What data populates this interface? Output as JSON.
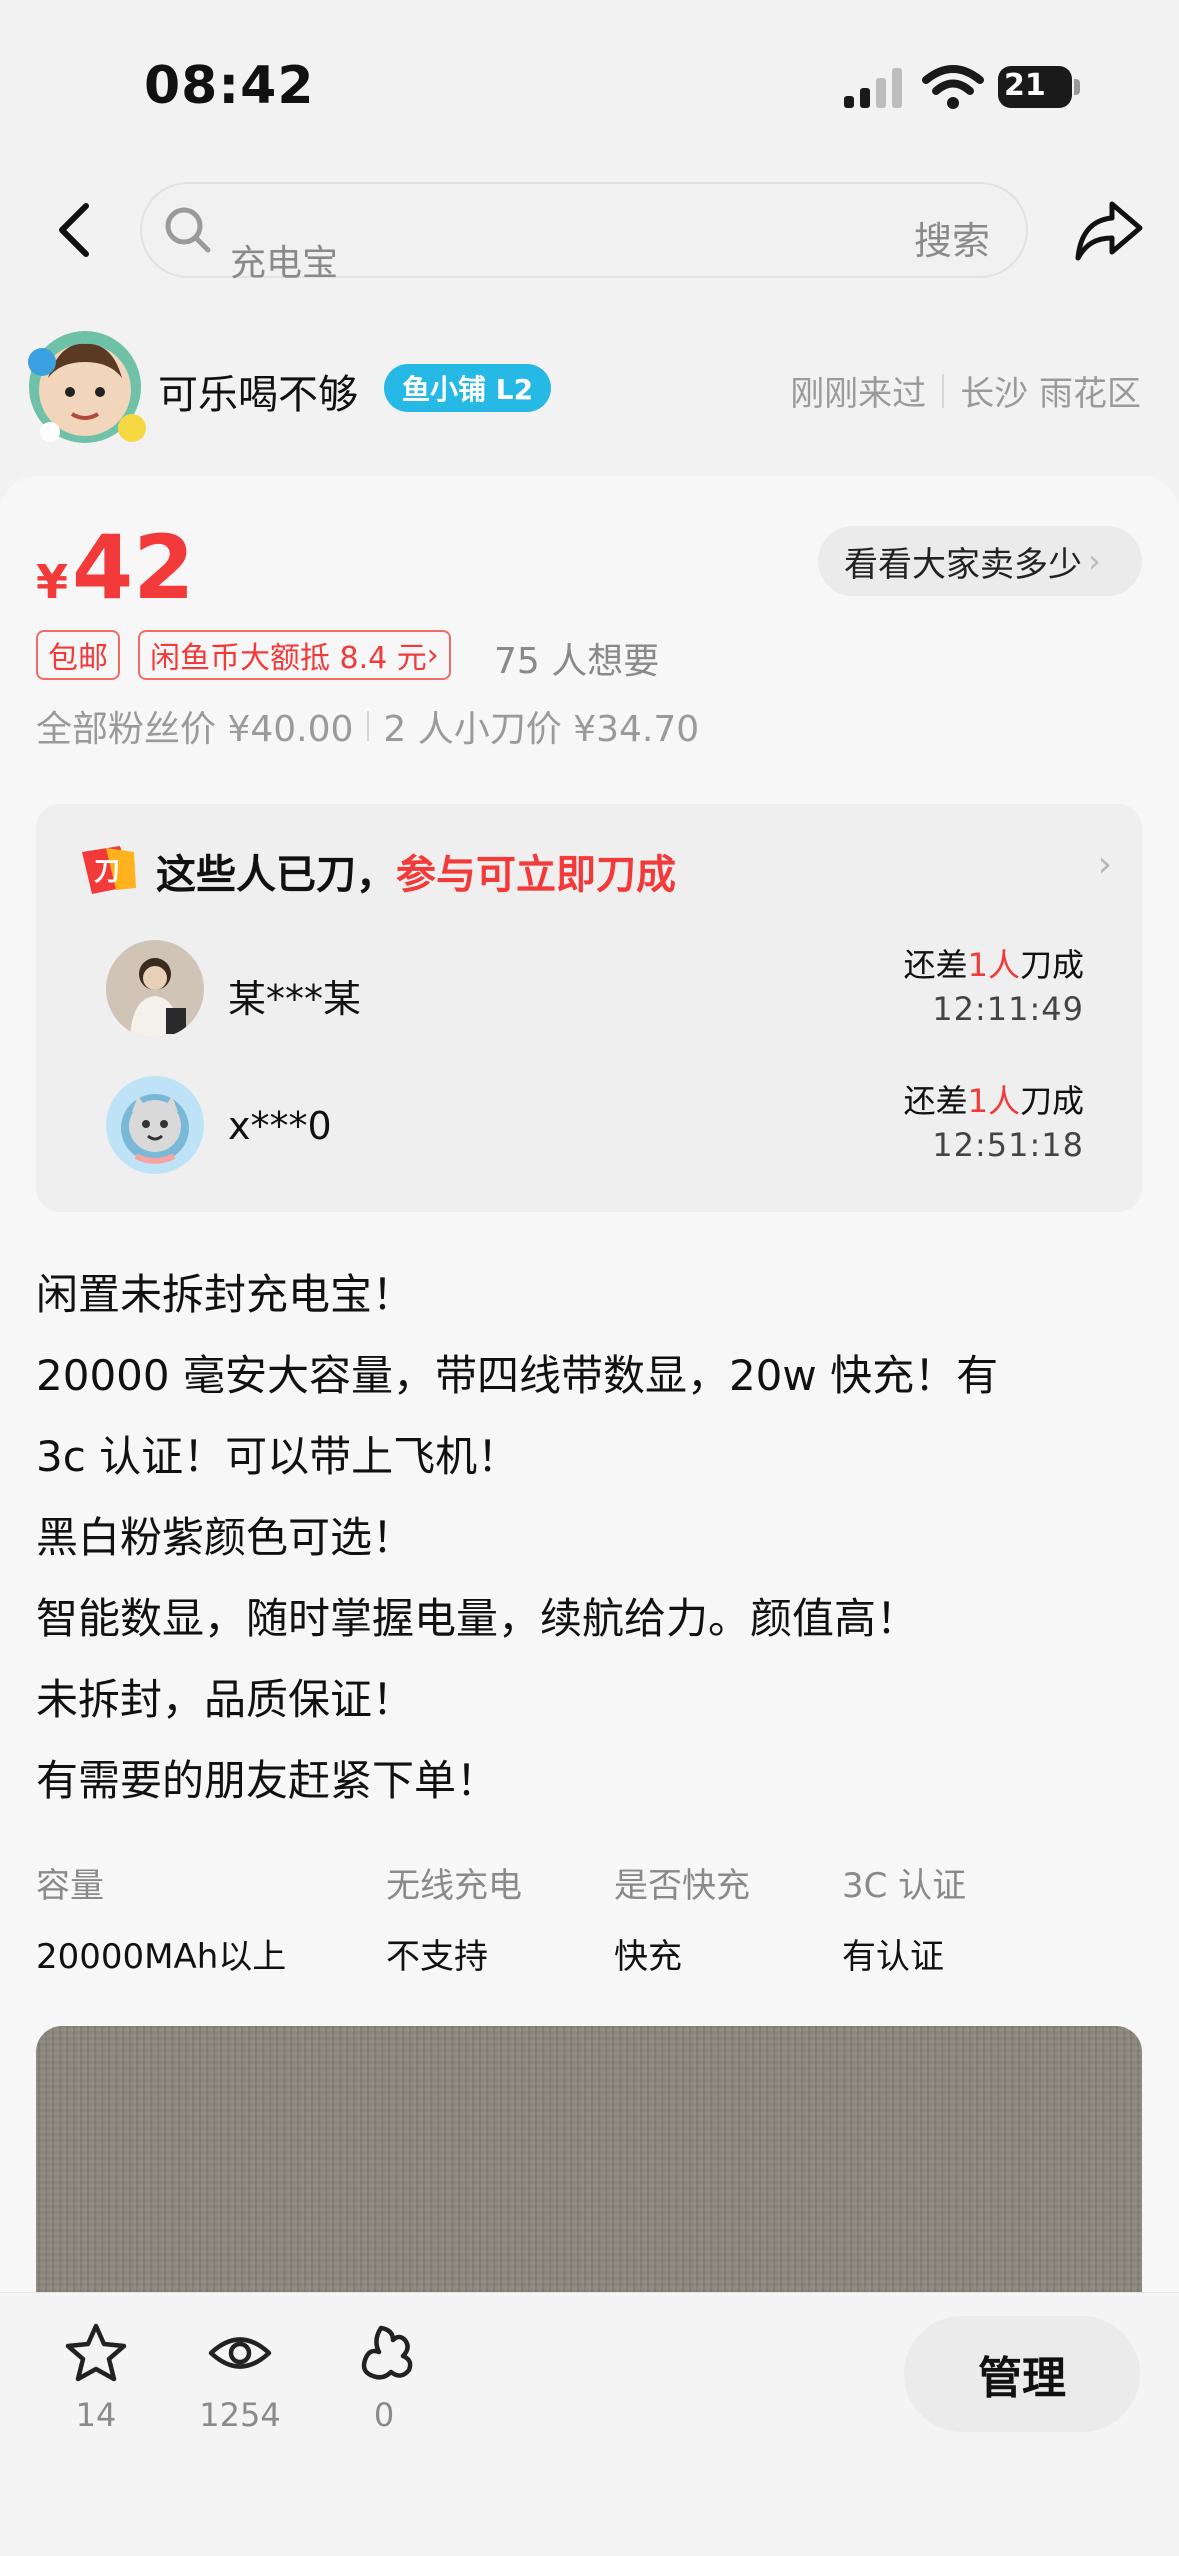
{
  "status_bar": {
    "time": "08:42",
    "battery": "21"
  },
  "search": {
    "query": "充电宝",
    "button_label": "搜索"
  },
  "seller": {
    "name": "可乐喝不够",
    "shop_level": "鱼小铺 L2",
    "last_visit": "刚刚来过",
    "location": "长沙 雨花区"
  },
  "price": {
    "symbol": "¥",
    "amount": "42",
    "compare_label": "看看大家卖多少",
    "tags": [
      "包邮",
      "闲鱼币大额抵 8.4 元"
    ],
    "want_count": "75 人想要",
    "fan_price": "全部粉丝价 ¥40.00",
    "group_price": "2 人小刀价 ¥34.70"
  },
  "bargain": {
    "title_prefix": "这些人已刀，",
    "title_highlight": "参与可立即刀成",
    "entries": [
      {
        "name": "某***某",
        "need_prefix": "还差",
        "need_count": "1人",
        "need_suffix": "刀成",
        "time": "12:11:49"
      },
      {
        "name": "x***0",
        "need_prefix": "还差",
        "need_count": "1人",
        "need_suffix": "刀成",
        "time": "12:51:18"
      }
    ]
  },
  "description": [
    "闲置未拆封充电宝！",
    "20000 毫安大容量，带四线带数显，20w 快充！有",
    "3c 认证！可以带上飞机！",
    "黑白粉紫颜色可选！",
    "智能数显，随时掌握电量，续航给力。颜值高！",
    "未拆封，品质保证！",
    "有需要的朋友赶紧下单！"
  ],
  "specs": [
    {
      "label": "容量",
      "value": "20000MAh以上"
    },
    {
      "label": "无线充电",
      "value": "不支持"
    },
    {
      "label": "是否快充",
      "value": "快充"
    },
    {
      "label": "3C 认证",
      "value": "有认证"
    }
  ],
  "bottom_bar": {
    "favorites": "14",
    "views": "1254",
    "likes": "0",
    "manage_label": "管理"
  },
  "colors": {
    "accent_red": "#f23a3a",
    "badge_blue": "#27b9e6"
  }
}
